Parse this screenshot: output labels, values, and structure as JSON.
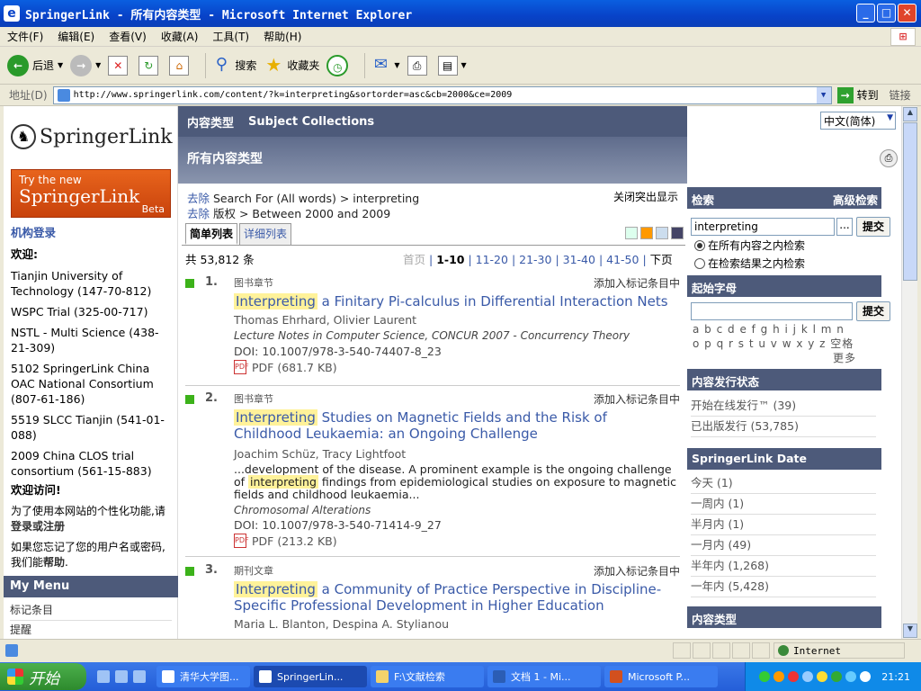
{
  "window": {
    "title": "SpringerLink - 所有内容类型 - Microsoft Internet Explorer"
  },
  "menu": [
    "文件(F)",
    "编辑(E)",
    "查看(V)",
    "收藏(A)",
    "工具(T)",
    "帮助(H)"
  ],
  "toolbar": {
    "back": "后退",
    "search": "搜索",
    "favorites": "收藏夹"
  },
  "address": {
    "label": "地址(D)",
    "url": "http://www.springerlink.com/content/?k=interpreting&sortorder=asc&cb=2000&ce=2009",
    "go": "转到",
    "links": "链接"
  },
  "left": {
    "logo": "SpringerLink",
    "beta": {
      "line1": "Try the new",
      "line2": "SpringerLink",
      "line3": "Beta"
    },
    "inst_login": "机构登录",
    "welcome": "欢迎:",
    "institutions": [
      "Tianjin University of Technology (147-70-812)",
      "WSPC Trial (325-00-717)",
      "NSTL - Multi Science (438-21-309)",
      "5102 SpringerLink China OAC National Consortium (807-61-186)",
      "5519 SLCC Tianjin (541-01-088)",
      "2009 China CLOS trial consortium (561-15-883)"
    ],
    "welcome_visit": "欢迎访问!",
    "personalize": "为了使用本网站的个性化功能,请",
    "login_register": "登录或注册",
    "forgot": "如果您忘记了您的用户名或密码,我们能",
    "help": "帮助",
    "mymenu": "My Menu",
    "mymenu_items": [
      "标记条目",
      "提醒"
    ]
  },
  "center": {
    "nav": [
      "内容类型",
      "Subject Collections"
    ],
    "heading": "所有内容类型",
    "crumb1": {
      "remove": "去除",
      "text": "Search For (All words) > interpreting"
    },
    "crumb2": {
      "remove": "去除",
      "text": "版权 > Between 2000 and 2009"
    },
    "close_highlight": "关闭突出显示",
    "tabs": [
      "简单列表",
      "详细列表"
    ],
    "count": "共 53,812 条",
    "pager": {
      "first": "首页",
      "current": "1-10",
      "pages": [
        "11-20",
        "21-30",
        "31-40",
        "41-50"
      ],
      "next": "下页"
    },
    "results": [
      {
        "num": "1.",
        "kind": "图书章节",
        "add": "添加入标记条目中",
        "hl": "Interpreting",
        "title": "a Finitary Pi-calculus in Differential Interaction Nets",
        "authors": "Thomas Ehrhard, Olivier Laurent",
        "source": "Lecture Notes in Computer Science, CONCUR 2007  - Concurrency Theory",
        "doi": "DOI: 10.1007/978-3-540-74407-8_23",
        "pdf": "PDF (681.7 KB)"
      },
      {
        "num": "2.",
        "kind": "图书章节",
        "add": "添加入标记条目中",
        "hl": "Interpreting",
        "title": "Studies on Magnetic Fields and the Risk of Childhood Leukaemia: an Ongoing Challenge",
        "authors": "Joachim Schüz, Tracy Lightfoot",
        "snippet_before": "...development of the disease. A prominent example is the ongoing challenge of ",
        "snippet_hl": "interpreting",
        "snippet_after": " findings from epidemiological studies on exposure to magnetic fields and childhood leukaemia...",
        "source": "Chromosomal Alterations",
        "doi": "DOI: 10.1007/978-3-540-71414-9_27",
        "pdf": "PDF (213.2 KB)"
      },
      {
        "num": "3.",
        "kind": "期刊文章",
        "add": "添加入标记条目中",
        "hl": "Interpreting",
        "title": "a Community of Practice Perspective in Discipline-Specific Professional Development in Higher Education",
        "authors": "Maria L. Blanton, Despina A. Stylianou"
      }
    ]
  },
  "right": {
    "lang": "中文(简体)",
    "search_head": "检索",
    "adv_search": "高级检索",
    "search_value": "interpreting",
    "dots": "...",
    "submit": "提交",
    "scope1": "在所有内容之内检索",
    "scope2": "在检索结果之内检索",
    "start_letter": "起始字母",
    "letters1": "a b c d e f g h i j k l m n",
    "letters2": "o p q r s t u v w x y z",
    "space": "空格",
    "more": "更多",
    "pub_status": "内容发行状态",
    "status_items": [
      "开始在线发行™ (39)",
      "已出版发行 (53,785)"
    ],
    "date_head": "SpringerLink Date",
    "date_items": [
      "今天 (1)",
      "一周内 (1)",
      "半月内 (1)",
      "一月内 (49)",
      "半年内 (1,268)",
      "一年内 (5,428)"
    ],
    "type_head": "内容类型"
  },
  "status": {
    "zone": "Internet"
  },
  "taskbar": {
    "start": "开始",
    "tasks": [
      "清华大学图...",
      "SpringerLin...",
      "F:\\文献检索",
      "文档 1 - Mi...",
      "Microsoft P..."
    ],
    "clock": "21:21"
  }
}
